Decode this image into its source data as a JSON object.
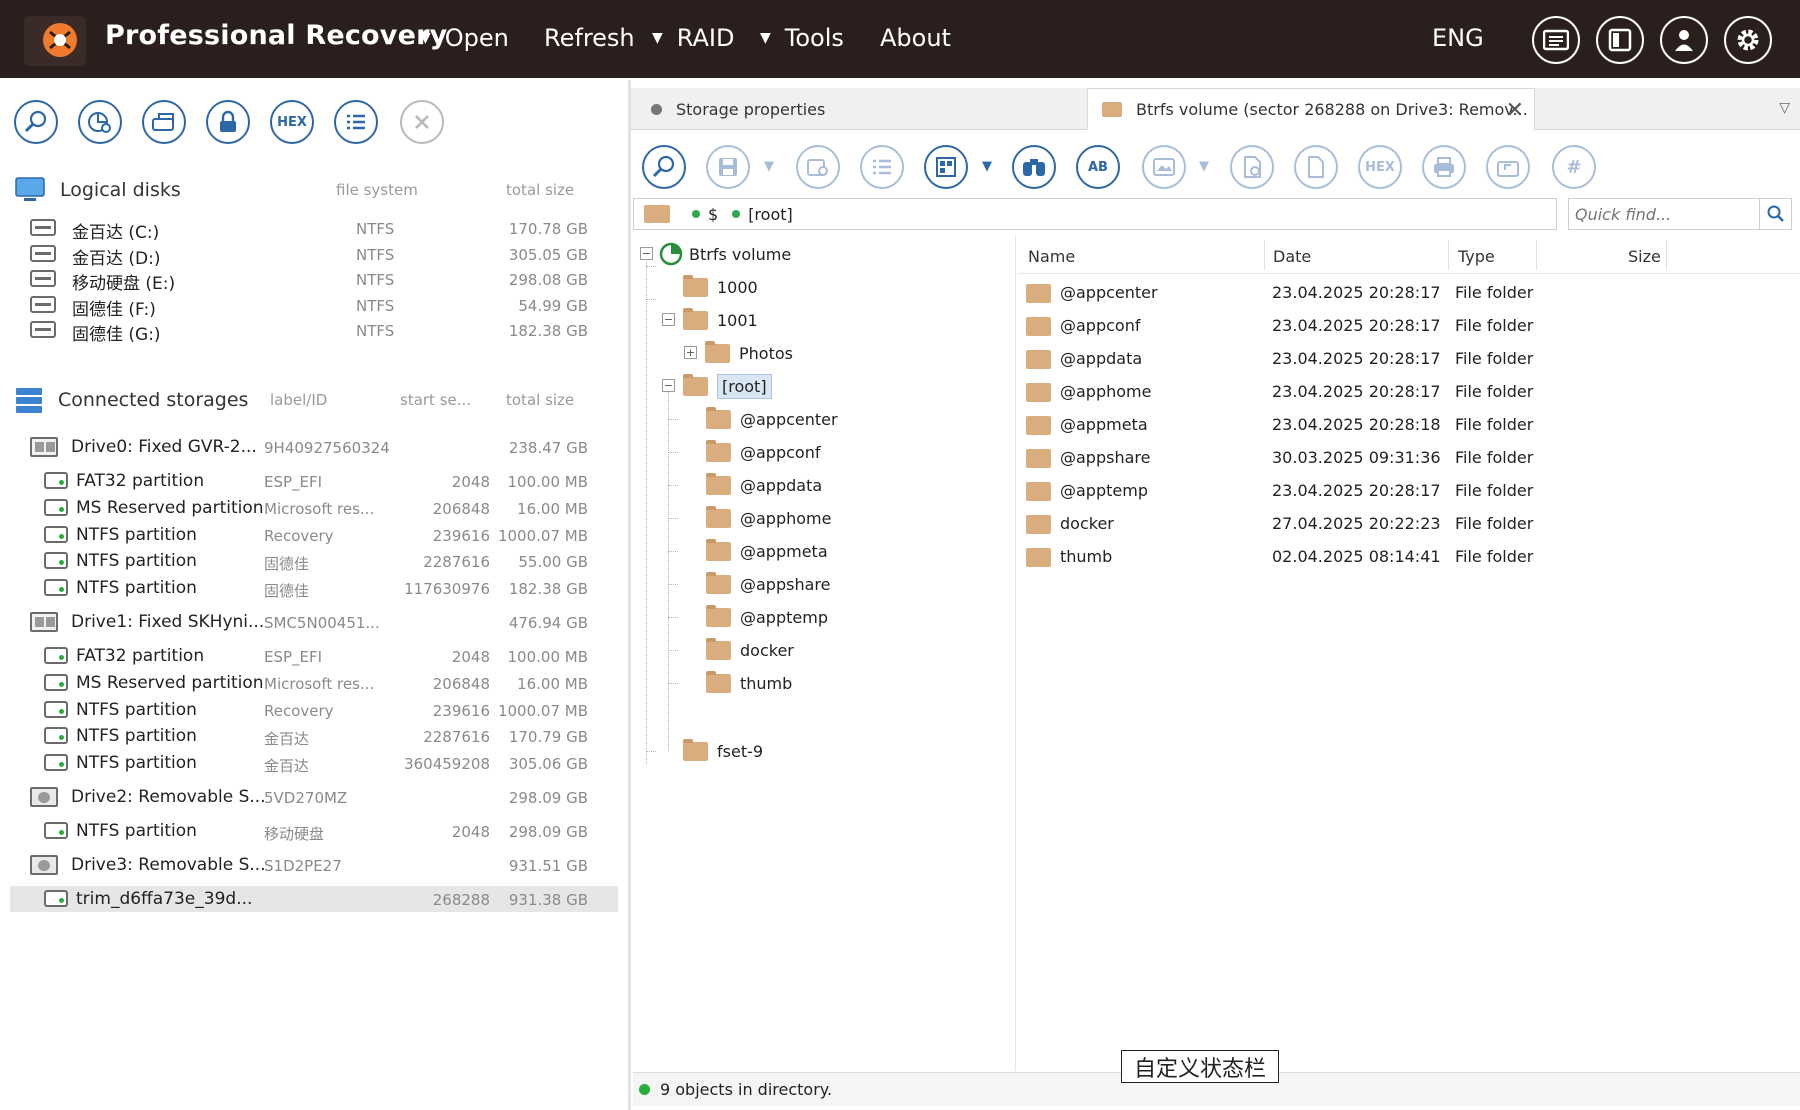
{
  "app": {
    "title": "Professional Recovery"
  },
  "menu": {
    "open": "Open",
    "refresh": "Refresh",
    "raid": "RAID",
    "tools": "Tools",
    "about": "About",
    "lang": "ENG"
  },
  "colors": {
    "accent": "#2c67a8",
    "titlebar": "#2b1f1d",
    "folder": "#d9ad7d",
    "ok": "#27ae3a"
  },
  "left_toolbar": {
    "hex_label": "HEX"
  },
  "logical": {
    "title": "Logical disks",
    "col_fs": "file system",
    "col_size": "total size",
    "items": [
      {
        "name": "金百达 (C:)",
        "fs": "NTFS",
        "size": "170.78 GB"
      },
      {
        "name": "金百达 (D:)",
        "fs": "NTFS",
        "size": "305.05 GB"
      },
      {
        "name": "移动硬盘 (E:)",
        "fs": "NTFS",
        "size": "298.08 GB"
      },
      {
        "name": "固德佳 (F:)",
        "fs": "NTFS",
        "size": "54.99 GB"
      },
      {
        "name": "固德佳 (G:)",
        "fs": "NTFS",
        "size": "182.38 GB"
      }
    ]
  },
  "storages": {
    "title": "Connected storages",
    "col_label": "label/ID",
    "col_start": "start se...",
    "col_size": "total size",
    "items": [
      {
        "kind": "disk",
        "name": "Drive0: Fixed GVR-2...",
        "label": "9H40927560324",
        "start": "",
        "size": "238.47 GB"
      },
      {
        "kind": "part",
        "name": "FAT32 partition",
        "label": "ESP_EFI",
        "start": "2048",
        "size": "100.00 MB"
      },
      {
        "kind": "part",
        "name": "MS Reserved partition",
        "label": "Microsoft res...",
        "start": "206848",
        "size": "16.00 MB"
      },
      {
        "kind": "part",
        "name": "NTFS partition",
        "label": "Recovery",
        "start": "239616",
        "size": "1000.07 MB"
      },
      {
        "kind": "part",
        "name": "NTFS partition",
        "label": "固德佳",
        "start": "2287616",
        "size": "55.00 GB"
      },
      {
        "kind": "part",
        "name": "NTFS partition",
        "label": "固德佳",
        "start": "117630976",
        "size": "182.38 GB"
      },
      {
        "kind": "disk",
        "name": "Drive1: Fixed SKHyni...",
        "label": "SMC5N00451...",
        "start": "",
        "size": "476.94 GB"
      },
      {
        "kind": "part",
        "name": "FAT32 partition",
        "label": "ESP_EFI",
        "start": "2048",
        "size": "100.00 MB"
      },
      {
        "kind": "part",
        "name": "MS Reserved partition",
        "label": "Microsoft res...",
        "start": "206848",
        "size": "16.00 MB"
      },
      {
        "kind": "part",
        "name": "NTFS partition",
        "label": "Recovery",
        "start": "239616",
        "size": "1000.07 MB"
      },
      {
        "kind": "part",
        "name": "NTFS partition",
        "label": "金百达",
        "start": "2287616",
        "size": "170.79 GB"
      },
      {
        "kind": "part",
        "name": "NTFS partition",
        "label": "金百达",
        "start": "360459208",
        "size": "305.06 GB"
      },
      {
        "kind": "rem",
        "name": "Drive2: Removable S...",
        "label": "5VD270MZ",
        "start": "",
        "size": "298.09 GB"
      },
      {
        "kind": "part",
        "name": "NTFS partition",
        "label": "移动硬盘",
        "start": "2048",
        "size": "298.09 GB"
      },
      {
        "kind": "rem",
        "name": "Drive3: Removable S...",
        "label": "S1D2PE27",
        "start": "",
        "size": "931.51 GB"
      },
      {
        "kind": "part",
        "name": "trim_d6ffa73e_39d...",
        "label": "",
        "start": "268288",
        "size": "931.38 GB",
        "selected": true
      }
    ]
  },
  "tabs": {
    "storage": "Storage properties",
    "btrfs": "Btrfs volume (sector 268288 on Drive3: Remov..."
  },
  "right_toolbar": {
    "hex_label": "HEX",
    "ab_label": "AB"
  },
  "path": {
    "seg1": "$",
    "seg2": "[root]"
  },
  "quickfind": {
    "placeholder": "Quick find..."
  },
  "tree": {
    "root": "Btrfs volume",
    "n1000": "1000",
    "n1001": "1001",
    "photos": "Photos",
    "rootdir": "[root]",
    "children": [
      "@appcenter",
      "@appconf",
      "@appdata",
      "@apphome",
      "@appmeta",
      "@appshare",
      "@apptemp",
      "docker",
      "thumb"
    ],
    "fset": "fset-9"
  },
  "list": {
    "col_name": "Name",
    "col_date": "Date",
    "col_type": "Type",
    "col_size": "Size",
    "rows": [
      {
        "name": "@appcenter",
        "date": "23.04.2025 20:28:17",
        "type": "File folder"
      },
      {
        "name": "@appconf",
        "date": "23.04.2025 20:28:17",
        "type": "File folder"
      },
      {
        "name": "@appdata",
        "date": "23.04.2025 20:28:17",
        "type": "File folder"
      },
      {
        "name": "@apphome",
        "date": "23.04.2025 20:28:17",
        "type": "File folder"
      },
      {
        "name": "@appmeta",
        "date": "23.04.2025 20:28:18",
        "type": "File folder"
      },
      {
        "name": "@appshare",
        "date": "30.03.2025 09:31:36",
        "type": "File folder"
      },
      {
        "name": "@apptemp",
        "date": "23.04.2025 20:28:17",
        "type": "File folder"
      },
      {
        "name": "docker",
        "date": "27.04.2025 20:22:23",
        "type": "File folder"
      },
      {
        "name": "thumb",
        "date": "02.04.2025 08:14:41",
        "type": "File folder"
      }
    ]
  },
  "status": {
    "text": "9 objects in directory.",
    "custom": "自定义状态栏"
  }
}
